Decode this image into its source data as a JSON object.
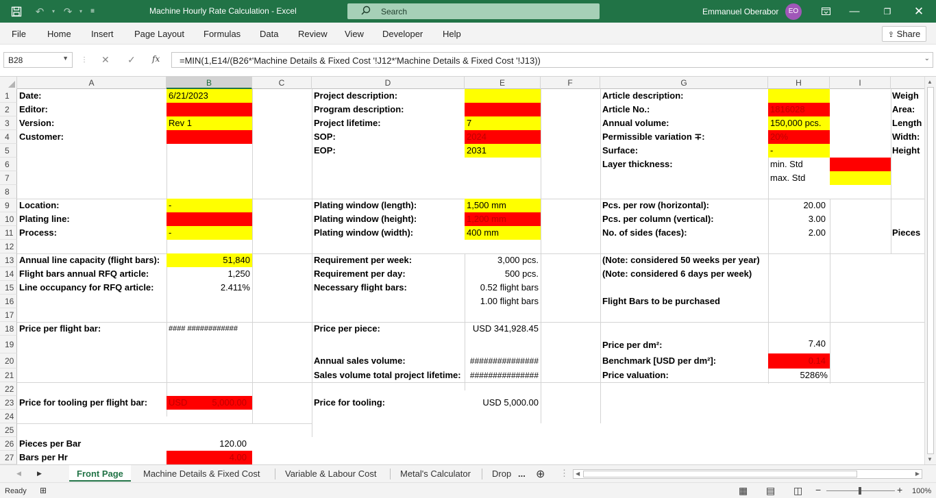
{
  "window": {
    "title": "Machine Hourly Rate Calculation  -  Excel",
    "search_placeholder": "Search",
    "user_name": "Emmanuel Oberabor",
    "user_initials": "EO"
  },
  "menu": [
    "File",
    "Home",
    "Insert",
    "Page Layout",
    "Formulas",
    "Data",
    "Review",
    "View",
    "Developer",
    "Help"
  ],
  "share_label": "Share",
  "formula_bar": {
    "name_box": "B28",
    "fx": "fx",
    "formula": "=MIN(1,E14/(B26*'Machine Details & Fixed Cost '!J12*'Machine Details & Fixed Cost '!J13))"
  },
  "columns": [
    "A",
    "B",
    "C",
    "D",
    "E",
    "F",
    "G",
    "H",
    "I"
  ],
  "selected_column": "B",
  "rows": [
    "1",
    "2",
    "3",
    "4",
    "5",
    "6",
    "7",
    "8",
    "9",
    "10",
    "11",
    "12",
    "13",
    "14",
    "15",
    "16",
    "17",
    "18",
    "19",
    "20",
    "21",
    "22",
    "23",
    "24",
    "25",
    "26",
    "27"
  ],
  "cells": {
    "A1": "Date:",
    "B1": "6/21/2023",
    "D1": "Project description:",
    "G1": "Article description:",
    "J1": "Weigh",
    "A2": "Editor:",
    "D2": "Program description:",
    "G2": "Article No.:",
    "H2": "1816028",
    "J2": "Area:",
    "A3": "Version:",
    "B3": "Rev 1",
    "D3": "Project lifetime:",
    "E3": "7",
    "G3": "Annual volume:",
    "H3": "150,000 pcs.",
    "J3": "Length",
    "A4": "Customer:",
    "D4": "SOP:",
    "E4": "2024",
    "G4": "Permissible variation ∓:",
    "H4": "20%",
    "J4": "Width:",
    "D5": "EOP:",
    "E5": "2031",
    "G5": "Surface:",
    "H5": "-",
    "J5": "Height",
    "G6": "Layer thickness:",
    "H6": "min. Std",
    "H7": "max. Std",
    "A9": "Location:",
    "B9": "-",
    "D9": "Plating window (length):",
    "E9": "1,500 mm",
    "G9": "Pcs. per row (horizontal):",
    "H9": "20.00",
    "A10": "Plating line:",
    "D10": "Plating window (height):",
    "E10": "1,200 mm",
    "G10": "Pcs. per column (vertical):",
    "H10": "3.00",
    "A11": "Process:",
    "B11": "-",
    "D11": "Plating window (width):",
    "E11": "400 mm",
    "G11": "No. of sides (faces):",
    "H11": "2.00",
    "J11": "Pieces",
    "A13": "Annual line capacity (flight bars):",
    "B13": "51,840",
    "D13": "Requirement per week:",
    "E13": "3,000 pcs.",
    "G13": "(Note: considered 50 weeks per year)",
    "A14": "Flight bars annual RFQ article:",
    "B14": "1,250",
    "D14": "Requirement per day:",
    "E14": "500 pcs.",
    "G14": "(Note: considered 6 days per week)",
    "A15": "Line occupancy for RFQ article:",
    "B15": "2.411%",
    "D15": "Necessary flight bars:",
    "E15": "0.52 flight bars",
    "E16": "1.00 flight bars",
    "G16": "Flight Bars to be purchased",
    "A18": "Price per flight bar:",
    "B18": "####  ############",
    "D18": "Price per piece:",
    "E18": "USD 341,928.45",
    "G19": "Price per dm²:",
    "H19": "7.40",
    "D20": "Annual sales volume:",
    "E20": "###############",
    "G20": "Benchmark [USD per dm²]:",
    "H20": "0.14",
    "D21": "Sales volume total project lifetime:",
    "E21": "###############",
    "G21": "Price valuation:",
    "H21": "5286%",
    "A23": "Price for tooling per flight bar:",
    "B23a": "USD",
    "B23b": "5,000.00",
    "D23": "Price for tooling:",
    "E23": "USD 5,000.00",
    "A26": "Pieces per Bar",
    "B26": "120.00",
    "A27": "Bars per Hr",
    "B27": "4.00"
  },
  "sheet_tabs": [
    "Front Page",
    "Machine Details & Fixed Cost",
    "Variable & Labour Cost",
    "Metal's Calculator",
    "Drop"
  ],
  "active_tab": "Front Page",
  "tab_more": "...",
  "status": {
    "ready": "Ready",
    "zoom": "100%"
  },
  "colors": {
    "excel_green": "#217346",
    "fill_yellow": "#FFFF00",
    "fill_red": "#FF0000"
  }
}
